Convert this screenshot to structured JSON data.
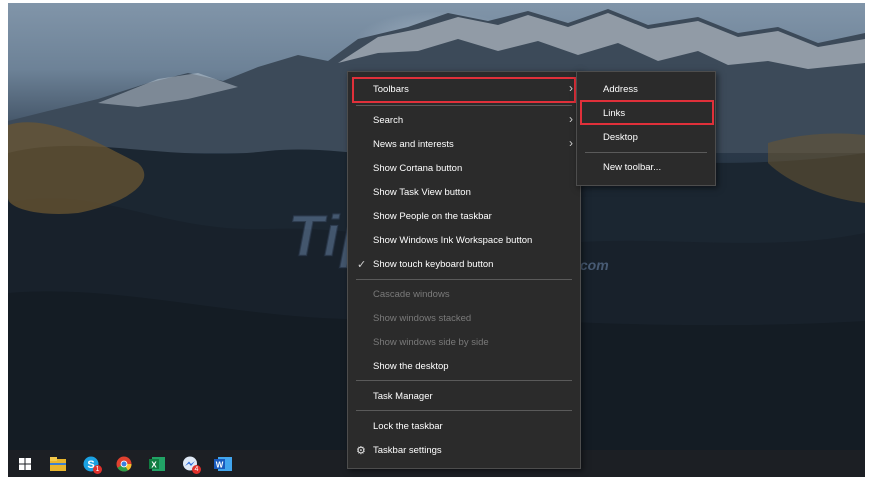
{
  "watermark": {
    "text": "TipsMake",
    "suffix": ".com"
  },
  "context_menu": {
    "items": [
      {
        "label": "Toolbars",
        "enabled": true,
        "submenu": true
      },
      {
        "label": "Search",
        "enabled": true,
        "submenu": true
      },
      {
        "label": "News and interests",
        "enabled": true,
        "submenu": true
      },
      {
        "label": "Show Cortana button",
        "enabled": true
      },
      {
        "label": "Show Task View button",
        "enabled": true
      },
      {
        "label": "Show People on the taskbar",
        "enabled": true
      },
      {
        "label": "Show Windows Ink Workspace button",
        "enabled": true
      },
      {
        "label": "Show touch keyboard button",
        "enabled": true,
        "checked": true
      },
      {
        "label": "Cascade windows",
        "enabled": false
      },
      {
        "label": "Show windows stacked",
        "enabled": false
      },
      {
        "label": "Show windows side by side",
        "enabled": false
      },
      {
        "label": "Show the desktop",
        "enabled": true
      },
      {
        "label": "Task Manager",
        "enabled": true
      },
      {
        "label": "Lock the taskbar",
        "enabled": true
      },
      {
        "label": "Taskbar settings",
        "enabled": true,
        "icon": "gear-icon"
      }
    ]
  },
  "toolbars_submenu": {
    "items": [
      {
        "label": "Address"
      },
      {
        "label": "Links"
      },
      {
        "label": "Desktop"
      },
      {
        "label": "New toolbar..."
      }
    ]
  },
  "highlight_color": "#e0303a",
  "taskbar": {
    "icons": [
      {
        "name": "start-icon"
      },
      {
        "name": "file-explorer-icon"
      },
      {
        "name": "skype-icon",
        "badge": "1"
      },
      {
        "name": "chrome-icon"
      },
      {
        "name": "excel-icon"
      },
      {
        "name": "messenger-icon",
        "badge": "4"
      },
      {
        "name": "word-icon"
      }
    ]
  }
}
